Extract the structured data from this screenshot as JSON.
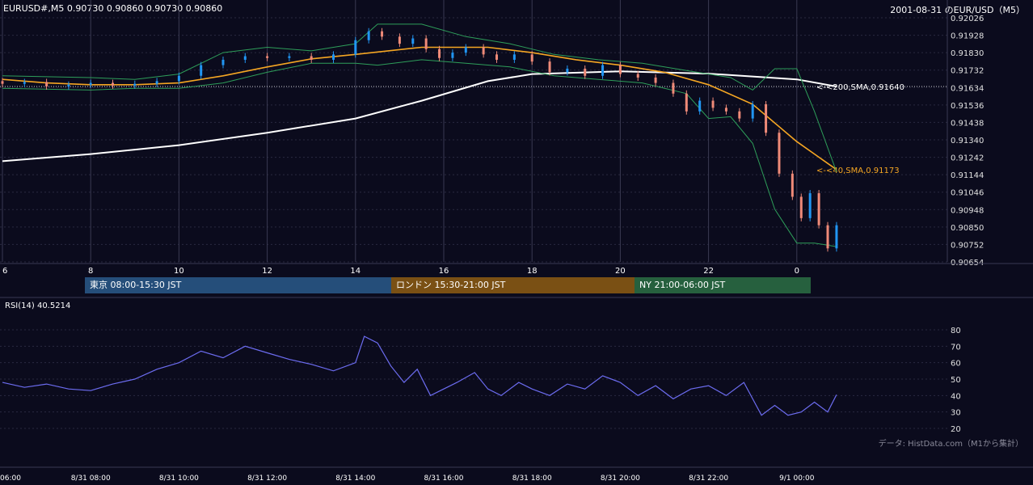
{
  "header": {
    "text": "EURUSD#,M5 0.90730 0.90860 0.90730 0.90860"
  },
  "title": "2001-08-31 のEUR/USD（M5）",
  "credit": "データ: HistData.com（M1から集計）",
  "sessions": [
    {
      "label": "東京 08:00-15:30 JST",
      "color": "#254e7a"
    },
    {
      "label": "ロンドン 15:30-21:00 JST",
      "color": "#7a5014"
    },
    {
      "label": "NY 21:00-06:00 JST",
      "color": "#26603e"
    }
  ],
  "colors": {
    "background": "#0b0b1d",
    "up": "#2196f3",
    "down": "#ef8a78",
    "sma40": "#f5a623",
    "sma200": "#ffffff",
    "bollinger": "#2e9e5a",
    "rsi": "#6c6cf0",
    "grid": "#2a2a40"
  },
  "chart_data": [
    {
      "type": "candlestick",
      "title": "2001-08-31 のEUR/USD（M5）",
      "ylim": [
        0.90654,
        0.92026
      ],
      "y_ticks": [
        "0.92026",
        "0.91928",
        "0.91830",
        "0.91732",
        "0.91634",
        "0.91536",
        "0.91438",
        "0.91340",
        "0.91242",
        "0.91144",
        "0.91046",
        "0.90948",
        "0.90850",
        "0.90752",
        "0.90654"
      ],
      "x_ticks": [
        "6",
        "8",
        "10",
        "12",
        "14",
        "16",
        "18",
        "20",
        "22",
        "0"
      ],
      "x_tick_hours": [
        6,
        8,
        10,
        12,
        14,
        16,
        18,
        20,
        22,
        24
      ],
      "xlim_hours": [
        6,
        24.9
      ],
      "series": [
        {
          "name": "200,SMA",
          "label": "<-<200,SMA,0.91640",
          "points": [
            [
              6,
              0.9122
            ],
            [
              8,
              0.9126
            ],
            [
              10,
              0.9131
            ],
            [
              12,
              0.9138
            ],
            [
              14,
              0.9146
            ],
            [
              15.5,
              0.9156
            ],
            [
              17,
              0.9167
            ],
            [
              18,
              0.9171
            ],
            [
              20,
              0.91725
            ],
            [
              22,
              0.91712
            ],
            [
              24,
              0.9168
            ],
            [
              24.9,
              0.9164
            ]
          ]
        },
        {
          "name": "40,SMA",
          "label": "<-<40,SMA,0.91173",
          "points": [
            [
              6,
              0.9168
            ],
            [
              7,
              0.9166
            ],
            [
              8,
              0.9165
            ],
            [
              9,
              0.9165
            ],
            [
              10,
              0.9166
            ],
            [
              11,
              0.917
            ],
            [
              12,
              0.9175
            ],
            [
              13,
              0.91795
            ],
            [
              14,
              0.9182
            ],
            [
              15.5,
              0.9186
            ],
            [
              17,
              0.9186
            ],
            [
              18,
              0.9183
            ],
            [
              19,
              0.9179
            ],
            [
              20,
              0.9176
            ],
            [
              21,
              0.9172
            ],
            [
              22,
              0.9165
            ],
            [
              23,
              0.9154
            ],
            [
              24,
              0.9133
            ],
            [
              24.9,
              0.91173
            ]
          ]
        },
        {
          "name": "BB upper",
          "points": [
            [
              6,
              0.917
            ],
            [
              8,
              0.9169
            ],
            [
              9,
              0.9168
            ],
            [
              10,
              0.9171
            ],
            [
              11,
              0.9183
            ],
            [
              12,
              0.9186
            ],
            [
              13,
              0.9184
            ],
            [
              14,
              0.9188
            ],
            [
              14.5,
              0.9199
            ],
            [
              15.5,
              0.9199
            ],
            [
              16.5,
              0.9192
            ],
            [
              17.5,
              0.9188
            ],
            [
              18.5,
              0.9182
            ],
            [
              19.5,
              0.9179
            ],
            [
              20.5,
              0.9177
            ],
            [
              21.5,
              0.9173
            ],
            [
              22.5,
              0.9169
            ],
            [
              23,
              0.9162
            ],
            [
              23.5,
              0.9174
            ],
            [
              24,
              0.9174
            ],
            [
              24.4,
              0.915
            ],
            [
              24.9,
              0.9116
            ]
          ]
        },
        {
          "name": "BB lower",
          "points": [
            [
              6,
              0.9163
            ],
            [
              8,
              0.9162
            ],
            [
              9,
              0.9163
            ],
            [
              10,
              0.9163
            ],
            [
              11,
              0.9166
            ],
            [
              12,
              0.9172
            ],
            [
              13,
              0.9177
            ],
            [
              14,
              0.9177
            ],
            [
              14.5,
              0.9176
            ],
            [
              15.5,
              0.9179
            ],
            [
              16.5,
              0.9177
            ],
            [
              17.5,
              0.9175
            ],
            [
              18.5,
              0.917
            ],
            [
              19.5,
              0.9168
            ],
            [
              20.5,
              0.9166
            ],
            [
              21.5,
              0.916
            ],
            [
              22,
              0.9146
            ],
            [
              22.5,
              0.9147
            ],
            [
              23,
              0.9132
            ],
            [
              23.5,
              0.9095
            ],
            [
              24,
              0.9076
            ],
            [
              24.4,
              0.9076
            ],
            [
              24.9,
              0.9074
            ]
          ]
        }
      ],
      "candles": [
        [
          6.0,
          0.9167,
          0.91655
        ],
        [
          6.5,
          0.91655,
          0.91665
        ],
        [
          7.0,
          0.91665,
          0.9164
        ],
        [
          7.5,
          0.9164,
          0.9165
        ],
        [
          8.0,
          0.9165,
          0.9166
        ],
        [
          8.5,
          0.9166,
          0.91645
        ],
        [
          9.0,
          0.91645,
          0.91655
        ],
        [
          9.5,
          0.91655,
          0.9167
        ],
        [
          10.0,
          0.9167,
          0.917
        ],
        [
          10.5,
          0.917,
          0.9176
        ],
        [
          11.0,
          0.9176,
          0.9179
        ],
        [
          11.5,
          0.9179,
          0.9181
        ],
        [
          12.0,
          0.9181,
          0.918
        ],
        [
          12.5,
          0.918,
          0.9181
        ],
        [
          13.0,
          0.9181,
          0.9179
        ],
        [
          13.5,
          0.9179,
          0.9182
        ],
        [
          14.0,
          0.9182,
          0.919
        ],
        [
          14.3,
          0.919,
          0.9195
        ],
        [
          14.6,
          0.9195,
          0.9192
        ],
        [
          15.0,
          0.9192,
          0.9188
        ],
        [
          15.3,
          0.9188,
          0.9191
        ],
        [
          15.6,
          0.9191,
          0.9185
        ],
        [
          15.9,
          0.9185,
          0.918
        ],
        [
          16.2,
          0.918,
          0.9183
        ],
        [
          16.5,
          0.9183,
          0.9186
        ],
        [
          16.9,
          0.9186,
          0.9182
        ],
        [
          17.2,
          0.9182,
          0.9179
        ],
        [
          17.6,
          0.9179,
          0.9182
        ],
        [
          18.0,
          0.9182,
          0.9178
        ],
        [
          18.4,
          0.9178,
          0.9172
        ],
        [
          18.8,
          0.9172,
          0.9174
        ],
        [
          19.2,
          0.9174,
          0.917
        ],
        [
          19.6,
          0.917,
          0.9176
        ],
        [
          20.0,
          0.9176,
          0.9171
        ],
        [
          20.4,
          0.9171,
          0.9169
        ],
        [
          20.8,
          0.9169,
          0.9166
        ],
        [
          21.2,
          0.9166,
          0.916
        ],
        [
          21.5,
          0.916,
          0.915
        ],
        [
          21.8,
          0.915,
          0.9156
        ],
        [
          22.1,
          0.9156,
          0.9152
        ],
        [
          22.4,
          0.9152,
          0.915
        ],
        [
          22.7,
          0.915,
          0.9146
        ],
        [
          23.0,
          0.9146,
          0.9154
        ],
        [
          23.3,
          0.9154,
          0.9138
        ],
        [
          23.6,
          0.9138,
          0.9115
        ],
        [
          23.9,
          0.9115,
          0.9102
        ],
        [
          24.1,
          0.9102,
          0.909
        ],
        [
          24.3,
          0.909,
          0.9104
        ],
        [
          24.5,
          0.9104,
          0.9086
        ],
        [
          24.7,
          0.9086,
          0.9073
        ],
        [
          24.9,
          0.9073,
          0.9086
        ]
      ]
    },
    {
      "type": "line",
      "title": "RSI(14) 40.5214",
      "ylim": [
        20,
        80
      ],
      "y_ticks": [
        "80",
        "70",
        "60",
        "50",
        "40",
        "30",
        "20"
      ],
      "x_ticks": [
        "06:00",
        "8/31 08:00",
        "8/31 10:00",
        "8/31 12:00",
        "8/31 14:00",
        "8/31 16:00",
        "8/31 18:00",
        "8/31 20:00",
        "8/31 22:00",
        "9/1 00:00"
      ],
      "x_tick_hours": [
        6,
        8,
        10,
        12,
        14,
        16,
        18,
        20,
        22,
        24
      ],
      "series": [
        {
          "name": "RSI(14)",
          "points": [
            [
              6,
              48
            ],
            [
              6.5,
              45
            ],
            [
              7,
              47
            ],
            [
              7.5,
              44
            ],
            [
              8,
              43
            ],
            [
              8.5,
              47
            ],
            [
              9,
              50
            ],
            [
              9.5,
              56
            ],
            [
              10,
              60
            ],
            [
              10.5,
              67
            ],
            [
              11,
              63
            ],
            [
              11.5,
              70
            ],
            [
              12,
              66
            ],
            [
              12.5,
              62
            ],
            [
              13,
              59
            ],
            [
              13.5,
              55
            ],
            [
              14,
              60
            ],
            [
              14.2,
              76
            ],
            [
              14.5,
              72
            ],
            [
              14.8,
              58
            ],
            [
              15.1,
              48
            ],
            [
              15.4,
              56
            ],
            [
              15.7,
              40
            ],
            [
              16,
              44
            ],
            [
              16.3,
              48
            ],
            [
              16.7,
              54
            ],
            [
              17,
              44
            ],
            [
              17.3,
              40
            ],
            [
              17.7,
              48
            ],
            [
              18,
              44
            ],
            [
              18.4,
              40
            ],
            [
              18.8,
              47
            ],
            [
              19.2,
              44
            ],
            [
              19.6,
              52
            ],
            [
              20,
              48
            ],
            [
              20.4,
              40
            ],
            [
              20.8,
              46
            ],
            [
              21.2,
              38
            ],
            [
              21.6,
              44
            ],
            [
              22,
              46
            ],
            [
              22.4,
              40
            ],
            [
              22.8,
              48
            ],
            [
              23.2,
              28
            ],
            [
              23.5,
              34
            ],
            [
              23.8,
              28
            ],
            [
              24.1,
              30
            ],
            [
              24.4,
              36
            ],
            [
              24.7,
              30
            ],
            [
              24.9,
              40.5
            ]
          ]
        }
      ]
    }
  ]
}
